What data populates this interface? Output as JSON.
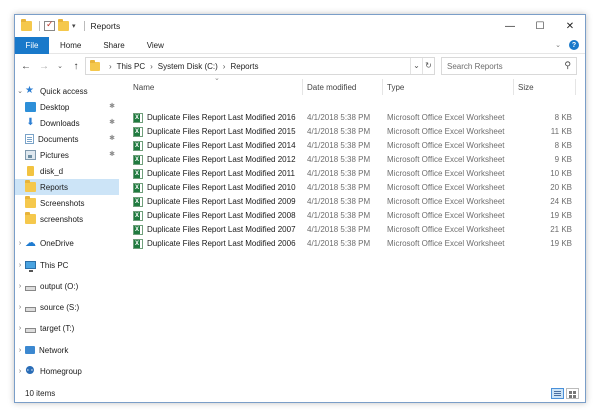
{
  "window": {
    "title": "Reports",
    "controls": {
      "minimize": "—",
      "maximize": "☐",
      "close": "✕"
    }
  },
  "ribbon": {
    "tabs": [
      "File",
      "Home",
      "Share",
      "View"
    ],
    "expand_glyph": "⌄",
    "help_glyph": "?"
  },
  "nav": {
    "back": "←",
    "forward": "→",
    "recent": "⌄",
    "up": "↑",
    "breadcrumb": [
      "This PC",
      "System Disk (C:)",
      "Reports"
    ],
    "breadcrumb_sep": "›",
    "dropdown_glyph": "⌄",
    "refresh_glyph": "↻",
    "search_placeholder": "Search Reports",
    "search_glyph": "⚲"
  },
  "sidebar": {
    "items": [
      {
        "label": "Quick access",
        "icon": "star-icon",
        "expand": "⌄",
        "pinned": false,
        "selected": false,
        "indent": 0
      },
      {
        "label": "Desktop",
        "icon": "desktop-icon",
        "expand": "",
        "pinned": true,
        "selected": false,
        "indent": 1
      },
      {
        "label": "Downloads",
        "icon": "download-icon",
        "expand": "",
        "pinned": true,
        "selected": false,
        "indent": 1
      },
      {
        "label": "Documents",
        "icon": "documents-icon",
        "expand": "",
        "pinned": true,
        "selected": false,
        "indent": 1
      },
      {
        "label": "Pictures",
        "icon": "pictures-icon",
        "expand": "",
        "pinned": true,
        "selected": false,
        "indent": 1
      },
      {
        "label": "disk_d",
        "icon": "usb-drive-icon",
        "expand": "",
        "pinned": false,
        "selected": false,
        "indent": 1
      },
      {
        "label": "Reports",
        "icon": "folder-icon",
        "expand": "",
        "pinned": false,
        "selected": true,
        "indent": 1
      },
      {
        "label": "Screenshots",
        "icon": "folder-icon",
        "expand": "",
        "pinned": false,
        "selected": false,
        "indent": 1
      },
      {
        "label": "screenshots",
        "icon": "folder-icon",
        "expand": "",
        "pinned": false,
        "selected": false,
        "indent": 1
      },
      {
        "label": "OneDrive",
        "icon": "cloud-icon",
        "expand": "›",
        "pinned": false,
        "selected": false,
        "indent": 0
      },
      {
        "label": "This PC",
        "icon": "computer-icon",
        "expand": "›",
        "pinned": false,
        "selected": false,
        "indent": 0
      },
      {
        "label": "output (O:)",
        "icon": "drive-icon",
        "expand": "›",
        "pinned": false,
        "selected": false,
        "indent": 0
      },
      {
        "label": "source (S:)",
        "icon": "drive-icon",
        "expand": "›",
        "pinned": false,
        "selected": false,
        "indent": 0
      },
      {
        "label": "target (T:)",
        "icon": "drive-icon",
        "expand": "›",
        "pinned": false,
        "selected": false,
        "indent": 0
      },
      {
        "label": "Network",
        "icon": "network-icon",
        "expand": "›",
        "pinned": false,
        "selected": false,
        "indent": 0
      },
      {
        "label": "Homegroup",
        "icon": "homegroup-icon",
        "expand": "›",
        "pinned": false,
        "selected": false,
        "indent": 0
      }
    ],
    "pin_glyph": "📌"
  },
  "list": {
    "sort_caret": "⌄",
    "columns": {
      "name": "Name",
      "date": "Date modified",
      "type": "Type",
      "size": "Size"
    },
    "rows": [
      {
        "name": "Duplicate Files Report Last Modified 2016",
        "date": "4/1/2018 5:38 PM",
        "type": "Microsoft Office Excel Worksheet",
        "size": "8 KB"
      },
      {
        "name": "Duplicate Files Report Last Modified 2015",
        "date": "4/1/2018 5:38 PM",
        "type": "Microsoft Office Excel Worksheet",
        "size": "11 KB"
      },
      {
        "name": "Duplicate Files Report Last Modified 2014",
        "date": "4/1/2018 5:38 PM",
        "type": "Microsoft Office Excel Worksheet",
        "size": "8 KB"
      },
      {
        "name": "Duplicate Files Report Last Modified 2012",
        "date": "4/1/2018 5:38 PM",
        "type": "Microsoft Office Excel Worksheet",
        "size": "9 KB"
      },
      {
        "name": "Duplicate Files Report Last Modified 2011",
        "date": "4/1/2018 5:38 PM",
        "type": "Microsoft Office Excel Worksheet",
        "size": "10 KB"
      },
      {
        "name": "Duplicate Files Report Last Modified 2010",
        "date": "4/1/2018 5:38 PM",
        "type": "Microsoft Office Excel Worksheet",
        "size": "20 KB"
      },
      {
        "name": "Duplicate Files Report Last Modified 2009",
        "date": "4/1/2018 5:38 PM",
        "type": "Microsoft Office Excel Worksheet",
        "size": "24 KB"
      },
      {
        "name": "Duplicate Files Report Last Modified 2008",
        "date": "4/1/2018 5:38 PM",
        "type": "Microsoft Office Excel Worksheet",
        "size": "19 KB"
      },
      {
        "name": "Duplicate Files Report Last Modified 2007",
        "date": "4/1/2018 5:38 PM",
        "type": "Microsoft Office Excel Worksheet",
        "size": "21 KB"
      },
      {
        "name": "Duplicate Files Report Last Modified 2006",
        "date": "4/1/2018 5:38 PM",
        "type": "Microsoft Office Excel Worksheet",
        "size": "19 KB"
      }
    ]
  },
  "status": {
    "count": "10 items"
  }
}
